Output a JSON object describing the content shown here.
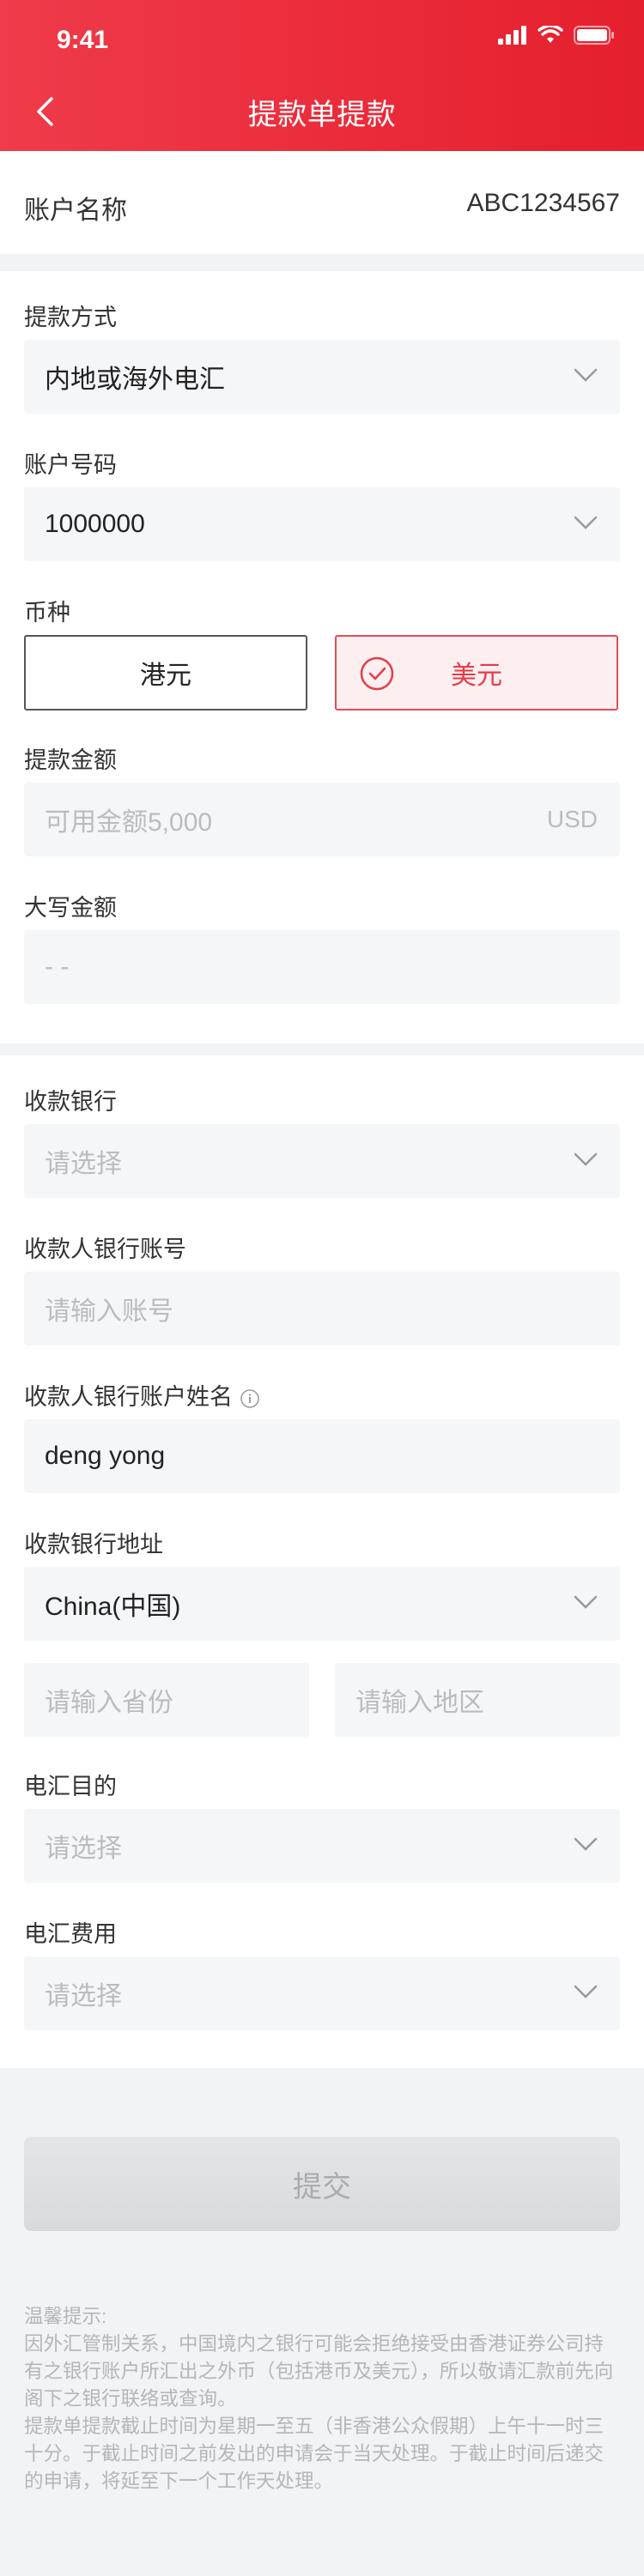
{
  "status_bar": {
    "time": "9:41"
  },
  "header": {
    "title": "提款单提款"
  },
  "account": {
    "label": "账户名称",
    "value": "ABC1234567"
  },
  "withdraw_method": {
    "label": "提款方式",
    "value": "内地或海外电汇"
  },
  "account_number": {
    "label": "账户号码",
    "value": "1000000"
  },
  "currency": {
    "label": "币种",
    "options": [
      "港元",
      "美元"
    ],
    "selected": "美元"
  },
  "amount": {
    "label": "提款金额",
    "placeholder": "可用金额5,000",
    "unit": "USD"
  },
  "amount_words": {
    "label": "大写金额",
    "value": "- -"
  },
  "bank": {
    "label": "收款银行",
    "placeholder": "请选择"
  },
  "bank_account": {
    "label": "收款人银行账号",
    "placeholder": "请输入账号"
  },
  "account_name": {
    "label": "收款人银行账户姓名",
    "value": "deng yong"
  },
  "bank_address": {
    "label": "收款银行地址",
    "country": "China(中国)",
    "province_placeholder": "请输入省份",
    "region_placeholder": "请输入地区"
  },
  "purpose": {
    "label": "电汇目的",
    "placeholder": "请选择"
  },
  "fee": {
    "label": "电汇费用",
    "placeholder": "请选择"
  },
  "submit": {
    "label": "提交"
  },
  "tips": {
    "title": "温馨提示:",
    "p1": "因外汇管制关系，中国境内之银行可能会拒绝接受由香港证券公司持有之银行账户所汇出之外币（包括港币及美元），所以敬请汇款前先向阁下之银行联络或查询。",
    "p2": "提款单提款截止时间为星期一至五（非香港公众假期）上午十一时三十分。于截止时间之前发出的申请会于当天处理。于截止时间后递交的申请，将延至下一个工作天处理。"
  },
  "colors": {
    "brand": "#e5272f",
    "placeholder": "#b9bcc1",
    "field_bg": "#f5f6f8"
  }
}
